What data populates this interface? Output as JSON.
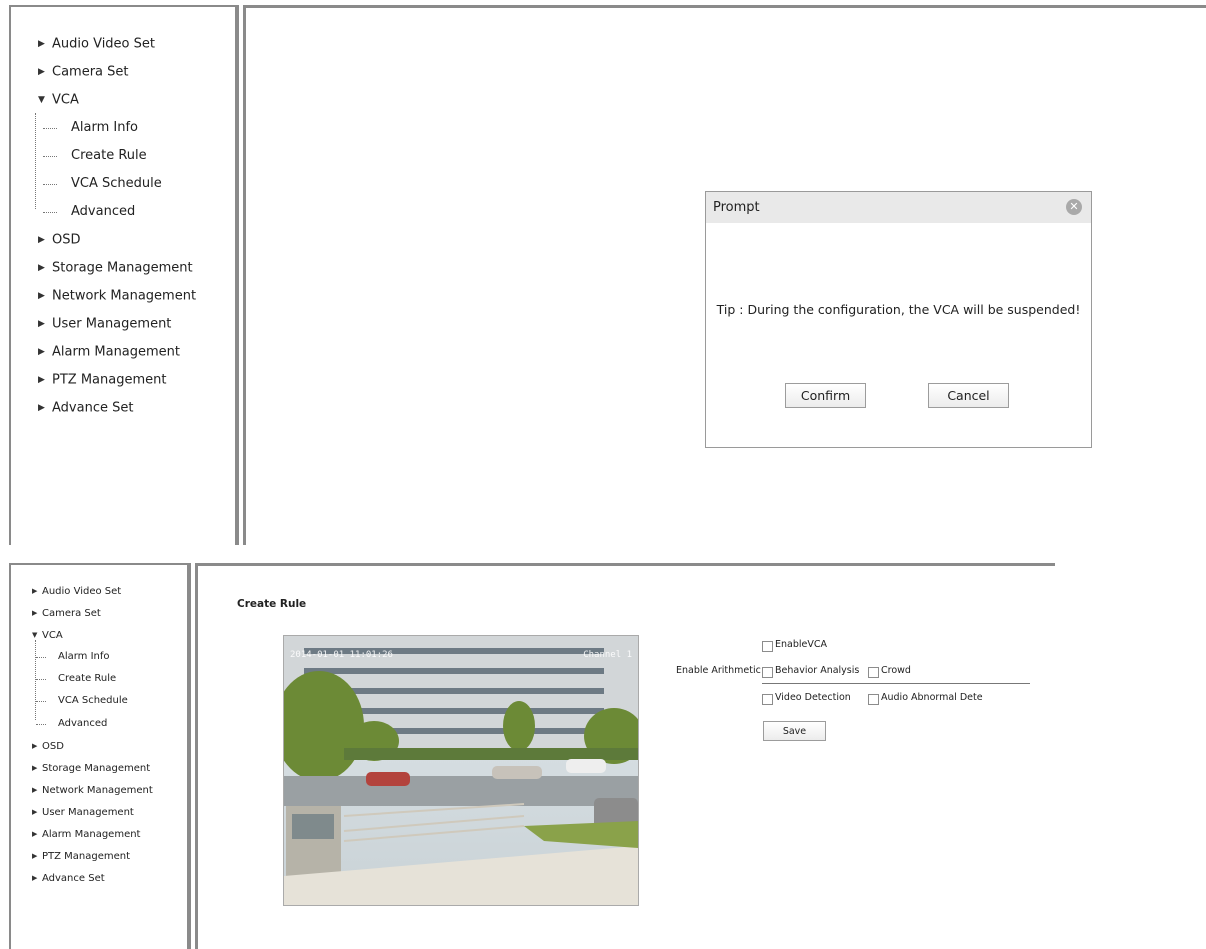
{
  "top": {
    "sidebar": {
      "items": [
        {
          "label": "Audio Video Set",
          "expanded": false
        },
        {
          "label": "Camera Set",
          "expanded": false
        },
        {
          "label": "VCA",
          "expanded": true,
          "children": [
            "Alarm Info",
            "Create Rule",
            "VCA Schedule",
            "Advanced"
          ]
        },
        {
          "label": "OSD",
          "expanded": false
        },
        {
          "label": "Storage Management",
          "expanded": false
        },
        {
          "label": "Network Management",
          "expanded": false
        },
        {
          "label": "User Management",
          "expanded": false
        },
        {
          "label": "Alarm Management",
          "expanded": false
        },
        {
          "label": "PTZ Management",
          "expanded": false
        },
        {
          "label": "Advance Set",
          "expanded": false
        }
      ]
    },
    "prompt": {
      "title": "Prompt",
      "message": "Tip : During the configuration, the VCA will be suspended!",
      "confirm_label": "Confirm",
      "cancel_label": "Cancel"
    }
  },
  "bottom": {
    "sidebar": {
      "items": [
        {
          "label": "Audio Video Set"
        },
        {
          "label": "Camera Set"
        },
        {
          "label": "VCA",
          "children": [
            "Alarm Info",
            "Create Rule",
            "VCA Schedule",
            "Advanced"
          ]
        },
        {
          "label": "OSD"
        },
        {
          "label": "Storage Management"
        },
        {
          "label": "Network Management"
        },
        {
          "label": "User Management"
        },
        {
          "label": "Alarm Management"
        },
        {
          "label": "PTZ Management"
        },
        {
          "label": "Advance Set"
        }
      ]
    },
    "create_rule": {
      "title": "Create Rule",
      "video_osd_time": "2014-01-01 11:01:26",
      "video_osd_channel": "Channel 1",
      "enable_vca_label": "EnableVCA",
      "enable_arithmetic_label": "Enable Arithmetic",
      "behavior_analysis_label": "Behavior Analysis",
      "crowd_label": "Crowd",
      "video_detection_label": "Video Detection",
      "audio_abnormal_label": "Audio Abnormal Dete",
      "save_label": "Save"
    }
  },
  "icons": {
    "collapsed": "triangle-right-icon",
    "expanded": "triangle-down-icon",
    "close": "close-circle-icon"
  }
}
